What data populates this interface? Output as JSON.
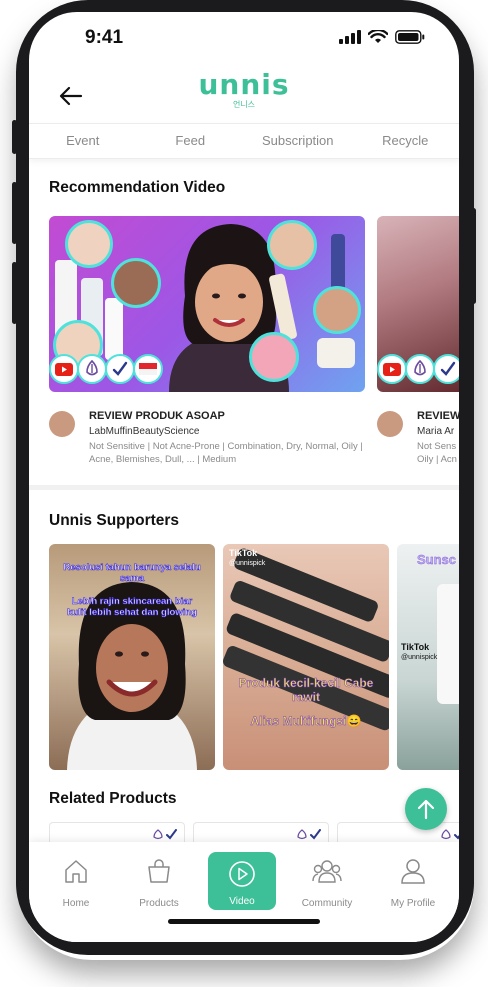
{
  "status_bar": {
    "time": "9:41"
  },
  "header": {
    "logo_text": "unnis",
    "logo_subtext": "언니스"
  },
  "tabs": [
    {
      "label": "Event"
    },
    {
      "label": "Feed"
    },
    {
      "label": "Subscription"
    },
    {
      "label": "Recycle"
    }
  ],
  "recommendation": {
    "title": "Recommendation Video",
    "videos": [
      {
        "title": "REVIEW PRODUK ASOAP",
        "channel": "LabMuffinBeautyScience",
        "tags": "Not Sensitive | Not Acne-Prone | Combination, Dry, Normal, Oily | Acne, Blemishes, Dull, ... | Medium"
      },
      {
        "title": "REVIEW",
        "channel": "Maria Ar",
        "tags": "Not Sens Oily | Acn"
      }
    ]
  },
  "supporters": {
    "title": "Unnis Supporters",
    "cards": [
      {
        "overlay_top": "Resolusi tahun barunya selalu sama",
        "overlay_mid": "Lebih rajin skincarean biar kulit lebih sehat dan glowing"
      },
      {
        "tiktok": "TikTok",
        "handle": "@unnispick",
        "overlay_a": "Produk kecil-kecil Cabe rawit",
        "overlay_b": "Alias Multifungsi😄"
      },
      {
        "overlay_top": "Sunsc Da",
        "tiktok": "TikTok",
        "handle": "@unnispick"
      }
    ]
  },
  "related": {
    "title": "Related Products"
  },
  "bottom_nav": [
    {
      "label": "Home",
      "icon": "home-icon"
    },
    {
      "label": "Products",
      "icon": "bag-icon"
    },
    {
      "label": "Video",
      "icon": "play-icon",
      "active": true
    },
    {
      "label": "Community",
      "icon": "community-icon"
    },
    {
      "label": "My Profile",
      "icon": "profile-icon"
    }
  ],
  "colors": {
    "accent": "#3dbf97",
    "ring": "#4ee2db"
  }
}
